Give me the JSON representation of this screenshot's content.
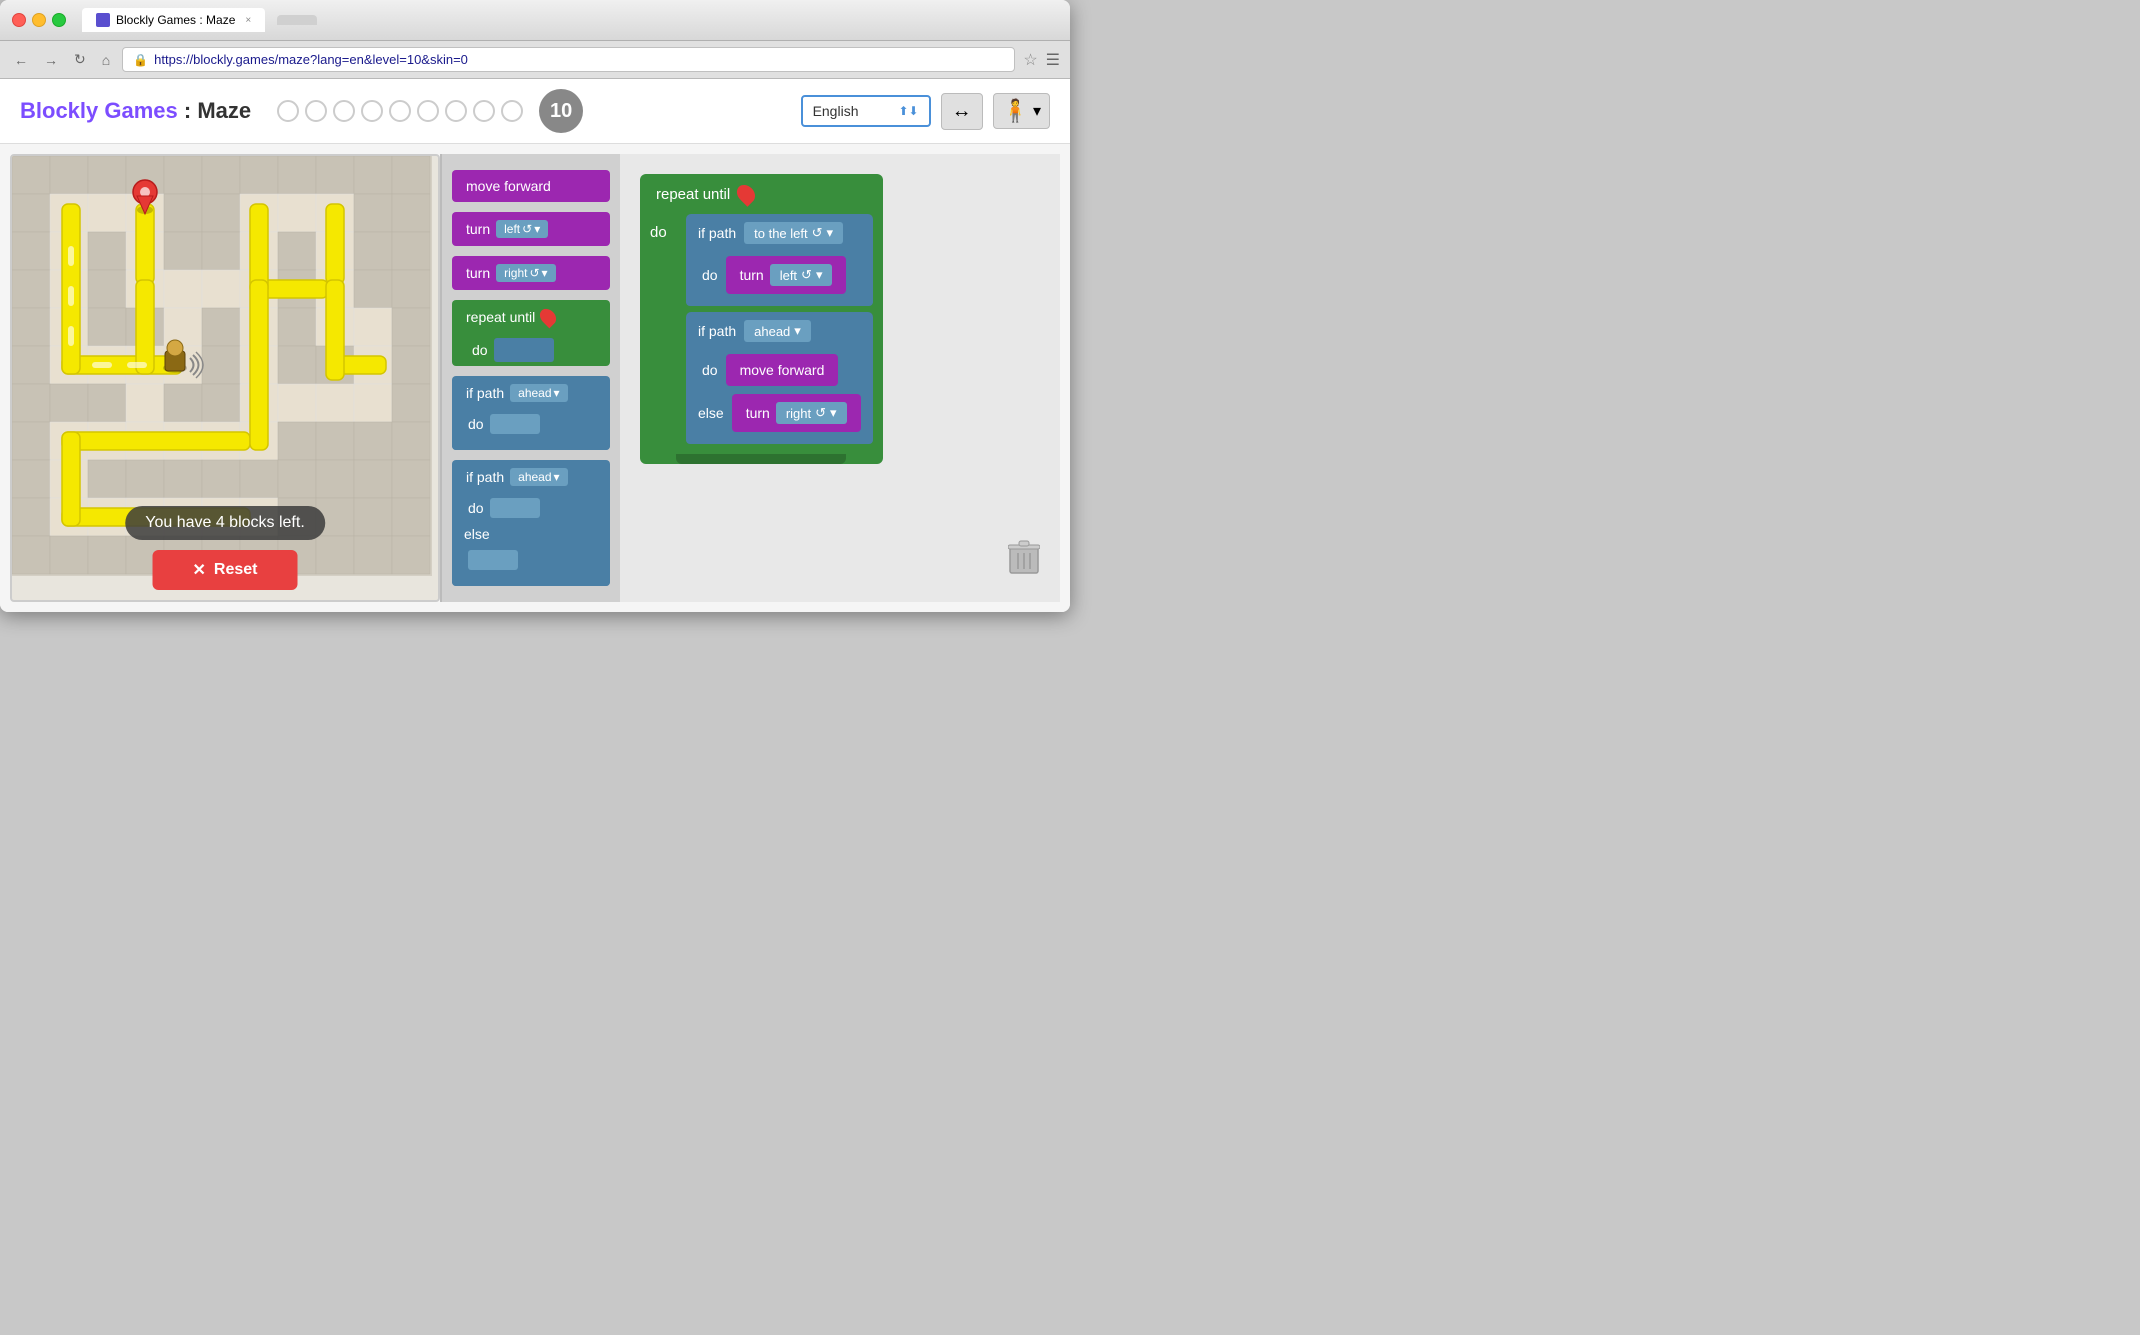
{
  "browser": {
    "tab_title": "Blockly Games : Maze",
    "tab_close": "×",
    "url": "https://blockly.games/maze?lang=en&level=10&skin=0",
    "nav": {
      "back": "←",
      "forward": "→",
      "reload": "↻",
      "home": "⌂"
    }
  },
  "header": {
    "title_blockly": "Blockly Games",
    "title_colon": " : ",
    "title_maze": "Maze",
    "level_count": 9,
    "current_level": "10",
    "language": "English",
    "link_icon": "↔",
    "avatar_icon": "👤"
  },
  "maze": {
    "status_text": "You have 4 blocks left.",
    "reset_label": "✕  Reset",
    "reset_x": "✕",
    "reset_text": "Reset"
  },
  "toolbox": {
    "blocks": [
      {
        "type": "move",
        "label": "move forward"
      },
      {
        "type": "turn_left",
        "label": "turn",
        "dropdown": "left"
      },
      {
        "type": "turn_right",
        "label": "turn",
        "dropdown": "right"
      },
      {
        "type": "repeat",
        "label": "repeat until"
      },
      {
        "type": "if_do",
        "label": "if path",
        "dropdown": "ahead"
      },
      {
        "type": "if_do_else",
        "label": "if path",
        "dropdown": "ahead"
      }
    ]
  },
  "workspace": {
    "repeat_label": "repeat until",
    "do_label": "do",
    "else_label": "else",
    "if_label": "if path",
    "path_left_dropdown": "to the left",
    "turn_left_dropdown": "left",
    "if_ahead_dropdown": "ahead",
    "move_forward": "move forward",
    "turn_right_dropdown": "right"
  },
  "trash": "🗑"
}
